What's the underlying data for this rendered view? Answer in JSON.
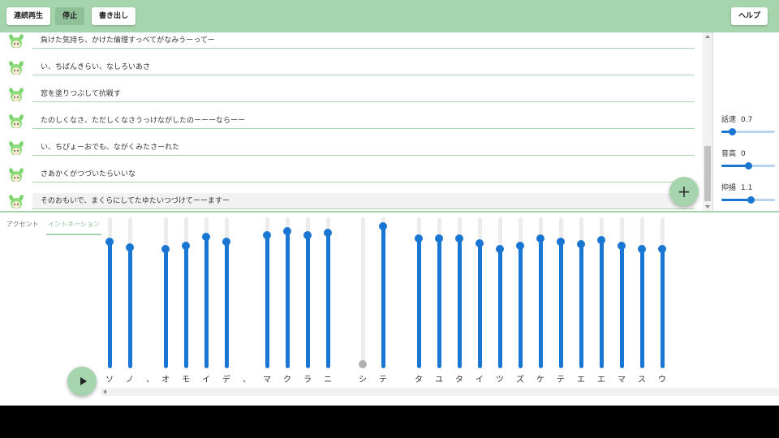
{
  "toolbar": {
    "continuous_play": "連続再生",
    "stop": "停止",
    "export": "書き出し",
    "help": "ヘルプ"
  },
  "lines": [
    {
      "text": "負けた気持ち、かけた倫理すっべてがなみうーってー"
    },
    {
      "text": "い、ちばんきらい、なしろいあさ"
    },
    {
      "text": "窓を塗りつぶして抗戦す"
    },
    {
      "text": "たのしくなさ、ただしくなさうっけながしたのーーーならーー"
    },
    {
      "text": "い、ちぴょーおでも、ながくみたさーれた"
    },
    {
      "text": "さあかくがつづいたらいいな"
    },
    {
      "text": "そのおもいで、まくらにしてたゆたいつづけてーーますー"
    }
  ],
  "params": [
    {
      "label": "話速",
      "value": "0.7",
      "level": 0.2
    },
    {
      "label": "音高",
      "value": "0",
      "level": 0.5
    },
    {
      "label": "抑揚",
      "value": "1.1",
      "level": 0.55
    }
  ],
  "tabs": {
    "accent": "アクセント",
    "intonation": "イントネーション"
  },
  "moras": [
    {
      "char": "ソ",
      "level": 0.84,
      "enabled": true
    },
    {
      "char": "ノ",
      "level": 0.8,
      "enabled": true
    },
    {
      "char": "、",
      "level": null,
      "enabled": false
    },
    {
      "char": "オ",
      "level": 0.79,
      "enabled": true
    },
    {
      "char": "モ",
      "level": 0.81,
      "enabled": true
    },
    {
      "char": "イ",
      "level": 0.87,
      "enabled": true
    },
    {
      "char": "デ",
      "level": 0.84,
      "enabled": true
    },
    {
      "char": "、",
      "level": null,
      "enabled": false
    },
    {
      "char": "マ",
      "level": 0.88,
      "enabled": true
    },
    {
      "char": "ク",
      "level": 0.91,
      "enabled": true
    },
    {
      "char": "ラ",
      "level": 0.88,
      "enabled": true
    },
    {
      "char": "ニ",
      "level": 0.9,
      "enabled": true
    },
    {
      "char": "シ",
      "level": 0.0,
      "enabled": false
    },
    {
      "char": "テ",
      "level": 0.94,
      "enabled": true
    },
    {
      "char": "タ",
      "level": 0.86,
      "enabled": true
    },
    {
      "char": "ユ",
      "level": 0.86,
      "enabled": true
    },
    {
      "char": "タ",
      "level": 0.86,
      "enabled": true
    },
    {
      "char": "イ",
      "level": 0.83,
      "enabled": true
    },
    {
      "char": "ツ",
      "level": 0.79,
      "enabled": true
    },
    {
      "char": "ズ",
      "level": 0.81,
      "enabled": true
    },
    {
      "char": "ケ",
      "level": 0.86,
      "enabled": true
    },
    {
      "char": "テ",
      "level": 0.84,
      "enabled": true
    },
    {
      "char": "エ",
      "level": 0.82,
      "enabled": true
    },
    {
      "char": "エ",
      "level": 0.85,
      "enabled": true
    },
    {
      "char": "マ",
      "level": 0.81,
      "enabled": true
    },
    {
      "char": "ス",
      "level": 0.79,
      "enabled": true
    },
    {
      "char": "ウ",
      "level": 0.79,
      "enabled": true
    }
  ],
  "colors": {
    "header": "#a5d4ad",
    "accent_blue": "#1976d2"
  },
  "icons": {
    "add": "plus-icon",
    "play": "play-icon",
    "avatar": "character-avatar-icon"
  }
}
